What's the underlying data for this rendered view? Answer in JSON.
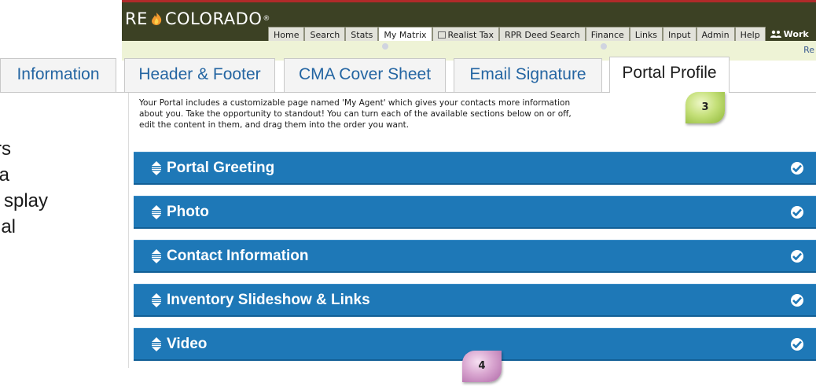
{
  "app": {
    "logo_left": "RE",
    "logo_right": "COLORADO",
    "logo_mark": "®",
    "menu": [
      {
        "label": "Home"
      },
      {
        "label": "Search"
      },
      {
        "label": "Stats"
      },
      {
        "label": "My Matrix"
      },
      {
        "label": "Realist Tax"
      },
      {
        "label": "RPR Deed Search"
      },
      {
        "label": "Finance"
      },
      {
        "label": "Links"
      },
      {
        "label": "Input"
      },
      {
        "label": "Admin"
      },
      {
        "label": "Help"
      },
      {
        "label": "Work"
      }
    ],
    "active_menu": "My Matrix",
    "subbar_text": "Re"
  },
  "tabs": [
    {
      "label": "Information"
    },
    {
      "label": "Header & Footer"
    },
    {
      "label": "CMA Cover Sheet"
    },
    {
      "label": "Email Signature"
    },
    {
      "label": "Portal Profile"
    }
  ],
  "active_tab": "Portal Profile",
  "description": {
    "line1": "Your Portal includes a customizable page named 'My Agent' which gives your contacts more information",
    "line2": "about you. Take the opportunity to standout! You can turn each of the available sections below on or off,",
    "line3": "edit the content in them, and drag them into the order you want."
  },
  "left_fragments": [
    "rs",
    "a",
    "splay",
    "al"
  ],
  "sections": [
    {
      "title": "Portal Greeting",
      "enabled": true
    },
    {
      "title": "Photo",
      "enabled": true
    },
    {
      "title": "Contact Information",
      "enabled": true
    },
    {
      "title": "Inventory Slideshow & Links",
      "enabled": true
    },
    {
      "title": "Video",
      "enabled": true
    }
  ],
  "callouts": {
    "tab_step": "3",
    "sections_step": "4"
  },
  "colors": {
    "panel_blue": "#1e78b7",
    "tab_link": "#2465a2",
    "topbar": "#3c4124"
  },
  "icons": {
    "drag": "drag-handle-icon",
    "check": "check-circle-icon",
    "work": "users-icon",
    "realist": "window-icon"
  }
}
